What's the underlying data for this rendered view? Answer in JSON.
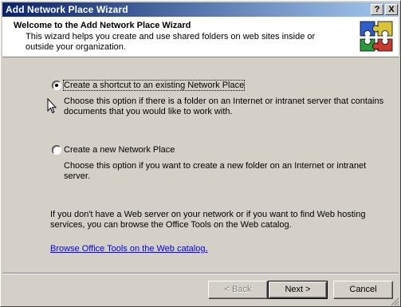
{
  "window": {
    "title": "Add Network Place Wizard",
    "help_glyph": "?",
    "close_glyph": "X"
  },
  "header": {
    "title": "Welcome to the Add Network Place Wizard",
    "subtitle": "This wizard helps you create and use shared folders on web sites inside or outside your organization.",
    "logo_icon": "puzzle-icon",
    "logo_colors": [
      "#2e5fc8",
      "#d8c23a",
      "#2a9b3a",
      "#c83a2e"
    ]
  },
  "options": [
    {
      "label": "Create a shortcut to an existing Network Place",
      "description": "Choose this option if there is a folder on an Internet or intranet server that contains documents that you would like to work with.",
      "selected": true
    },
    {
      "label": "Create a new Network Place",
      "description": "Choose this option if you want to create a new folder on an Internet or intranet server.",
      "selected": false
    }
  ],
  "info_text": "If you don't have a Web server on your network or if you want to find Web hosting services, you can browse the Office Tools on the Web catalog.",
  "link_text": "Browse Office Tools on the Web catalog.",
  "buttons": {
    "back": "< Back",
    "next": "Next >",
    "cancel": "Cancel"
  }
}
